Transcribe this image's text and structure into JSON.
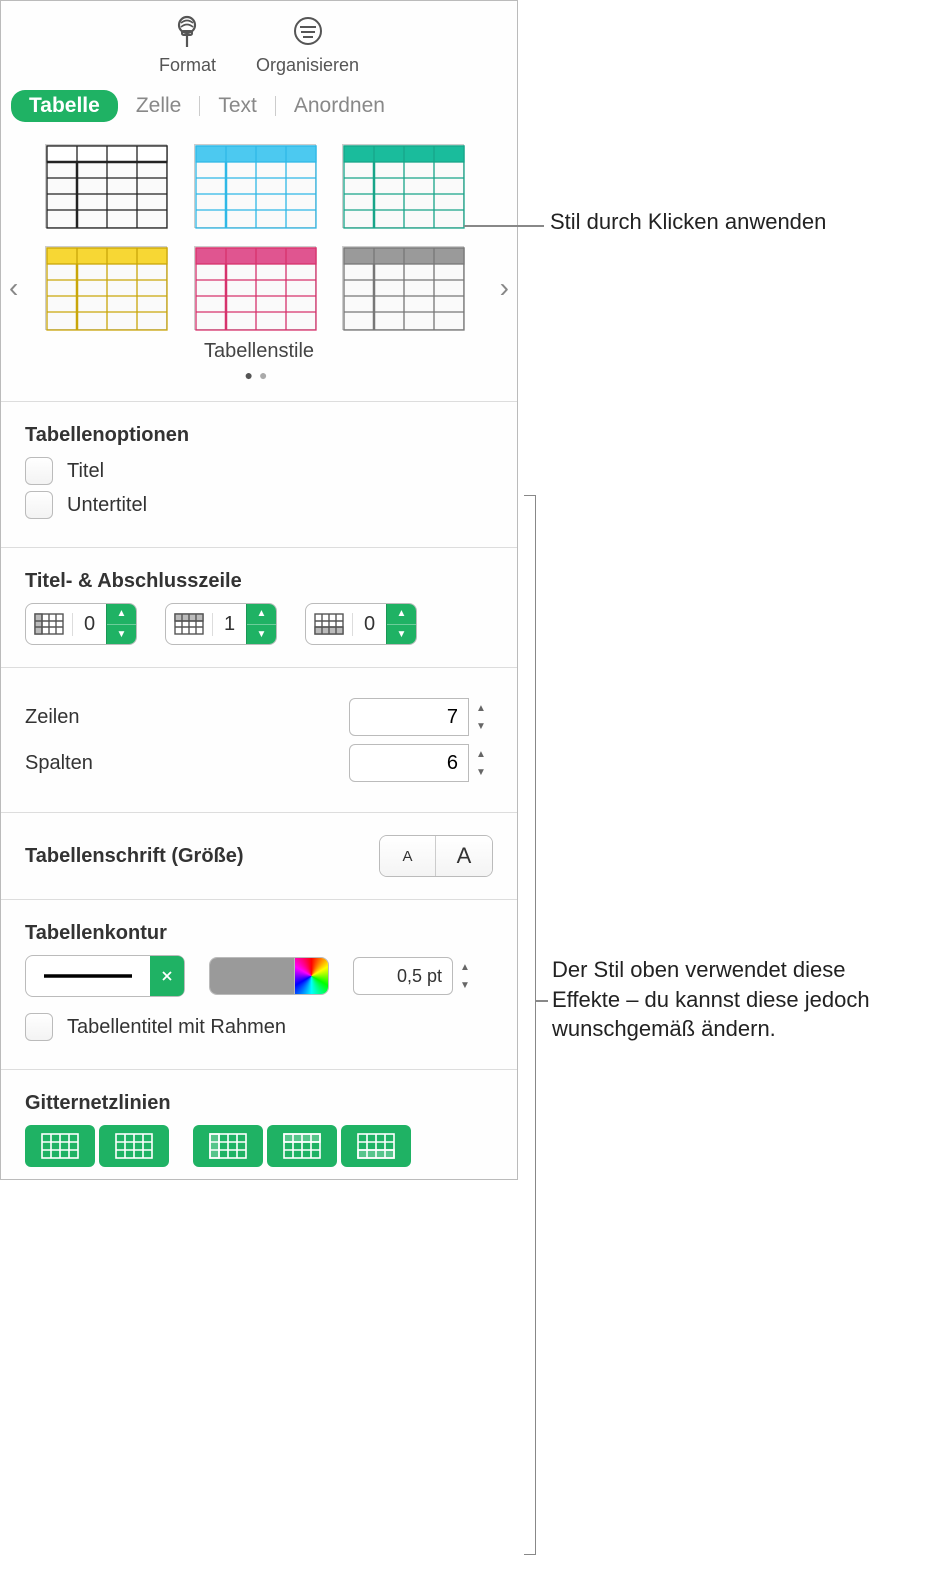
{
  "toolbar": {
    "format": "Format",
    "organize": "Organisieren"
  },
  "tabs": {
    "table": "Tabelle",
    "cell": "Zelle",
    "text": "Text",
    "arrange": "Anordnen"
  },
  "styles": {
    "label": "Tabellenstile",
    "colors": [
      "#000000",
      "#2fb8e6",
      "#17a589",
      "#f1c40f",
      "#d6336c",
      "#8d8d8d"
    ]
  },
  "options": {
    "heading": "Tabellenoptionen",
    "title": "Titel",
    "caption": "Untertitel"
  },
  "headers": {
    "heading": "Titel- & Abschlusszeile",
    "colHeaders": "0",
    "rowHeaders": "1",
    "footers": "0"
  },
  "rowsCols": {
    "rowsLabel": "Zeilen",
    "rowsValue": "7",
    "colsLabel": "Spalten",
    "colsValue": "6"
  },
  "font": {
    "label": "Tabellenschrift (Größe)"
  },
  "outline": {
    "heading": "Tabellenkontur",
    "ptValue": "0,5 pt",
    "titleBorder": "Tabellentitel mit Rahmen"
  },
  "gridlines": {
    "heading": "Gitternetzlinien"
  },
  "callouts": {
    "applyStyle": "Stil durch Klicken anwenden",
    "effects": "Der Stil oben verwendet diese Effekte – du kannst diese jedoch wunschgemäß ändern."
  }
}
